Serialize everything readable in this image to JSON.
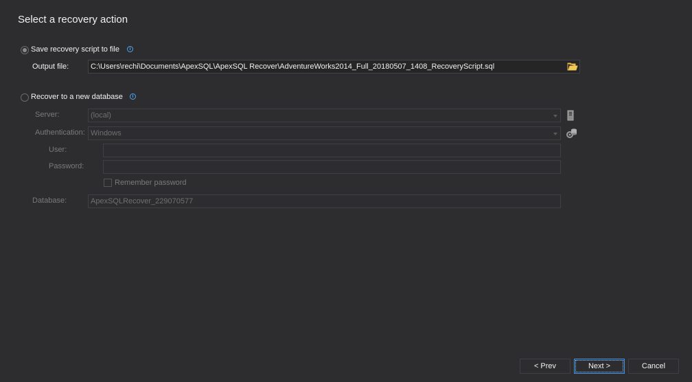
{
  "header": {
    "title": "Select a recovery action"
  },
  "options": {
    "save_script": {
      "label": "Save recovery script to file"
    },
    "output_file": {
      "label": "Output file:",
      "value": "C:\\Users\\rechi\\Documents\\ApexSQL\\ApexSQL Recover\\AdventureWorks2014_Full_20180507_1408_RecoveryScript.sql"
    },
    "recover_db": {
      "label": "Recover to a new database"
    }
  },
  "connection": {
    "server_label": "Server:",
    "server_value": "(local)",
    "auth_label": "Authentication:",
    "auth_value": "Windows",
    "user_label": "User:",
    "user_value": "",
    "password_label": "Password:",
    "password_value": "",
    "remember_label": "Remember password",
    "database_label": "Database:",
    "database_value": "ApexSQLRecover_229070577"
  },
  "footer": {
    "prev_label": "< Prev",
    "next_label": "Next >",
    "cancel_label": "Cancel"
  },
  "colors": {
    "background": "#2d2d30",
    "accent": "#3399ff",
    "info": "#4ea6f0"
  },
  "icons": {
    "info": "info-icon",
    "folder": "folder-icon",
    "server": "server-icon",
    "auth": "gear-database-icon"
  }
}
